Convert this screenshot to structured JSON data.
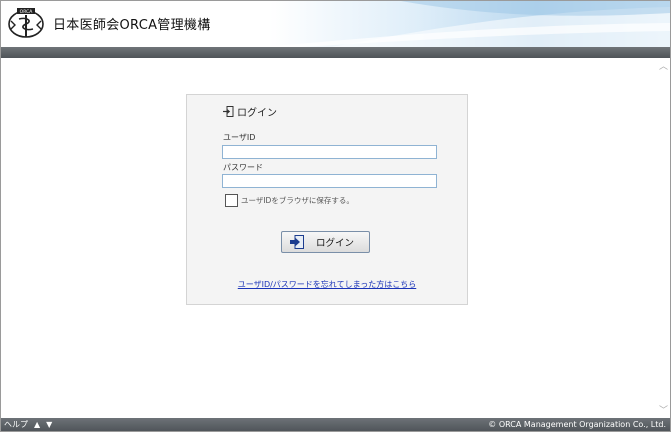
{
  "header": {
    "org_name": "日本医師会ORCA管理機構",
    "logo_text": "ORCA"
  },
  "login": {
    "title": "ログイン",
    "user_label": "ユーザID",
    "user_value": "",
    "password_label": "パスワード",
    "password_value": "",
    "remember_label": "ユーザIDをブラウザに保存する。",
    "remember_checked": false,
    "button_label": "ログイン",
    "forgot_link": "ユーザID/パスワードを忘れてしまった方はこちら"
  },
  "footer": {
    "help_label": "ヘルプ",
    "up_glyph": "▲",
    "down_glyph": "▼",
    "copyright": "© ORCA Management Organization Co., Ltd."
  },
  "colors": {
    "header_bar": "#4e5358",
    "input_border": "#8fb3d3",
    "link": "#1a33b8"
  }
}
